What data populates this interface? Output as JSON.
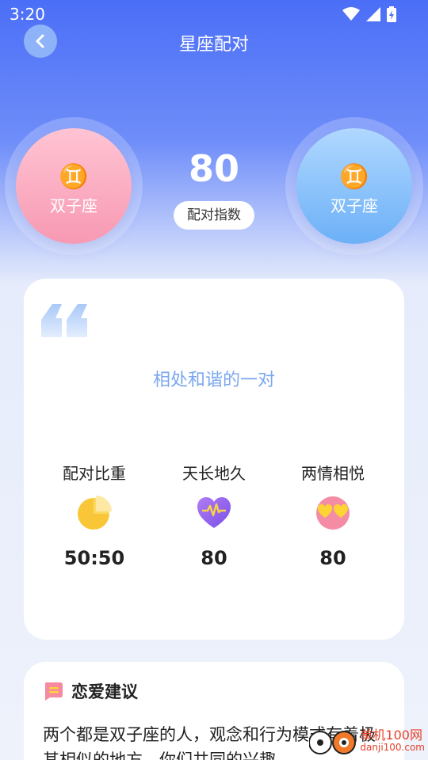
{
  "status_bar": {
    "time": "3:20"
  },
  "header": {
    "title": "星座配对"
  },
  "left_sign": {
    "glyph": "♊",
    "name": "双子座"
  },
  "right_sign": {
    "glyph": "♊",
    "name": "双子座"
  },
  "match": {
    "score": "80",
    "score_label": "配对指数"
  },
  "summary": {
    "text": "相处和谐的一对"
  },
  "metrics": [
    {
      "title": "配对比重",
      "value": "50:50",
      "icon": "pie-chart-icon"
    },
    {
      "title": "天长地久",
      "value": "80",
      "icon": "heartbeat-heart-icon"
    },
    {
      "title": "两情相悦",
      "value": "80",
      "icon": "heart-eyes-icon"
    }
  ],
  "advice": {
    "title": "恋爱建议",
    "text": "两个都是双子座的人，观念和行为模式有着极其相似的地方，你们共同的兴趣"
  },
  "watermark": {
    "text": "单机100网",
    "sub": "danji100.com"
  },
  "colors": {
    "accent_blue": "#4b6ef7",
    "summary_text": "#7ba7ef",
    "left_sign_pink": "#f799b3",
    "right_sign_blue": "#6cb0f7"
  }
}
